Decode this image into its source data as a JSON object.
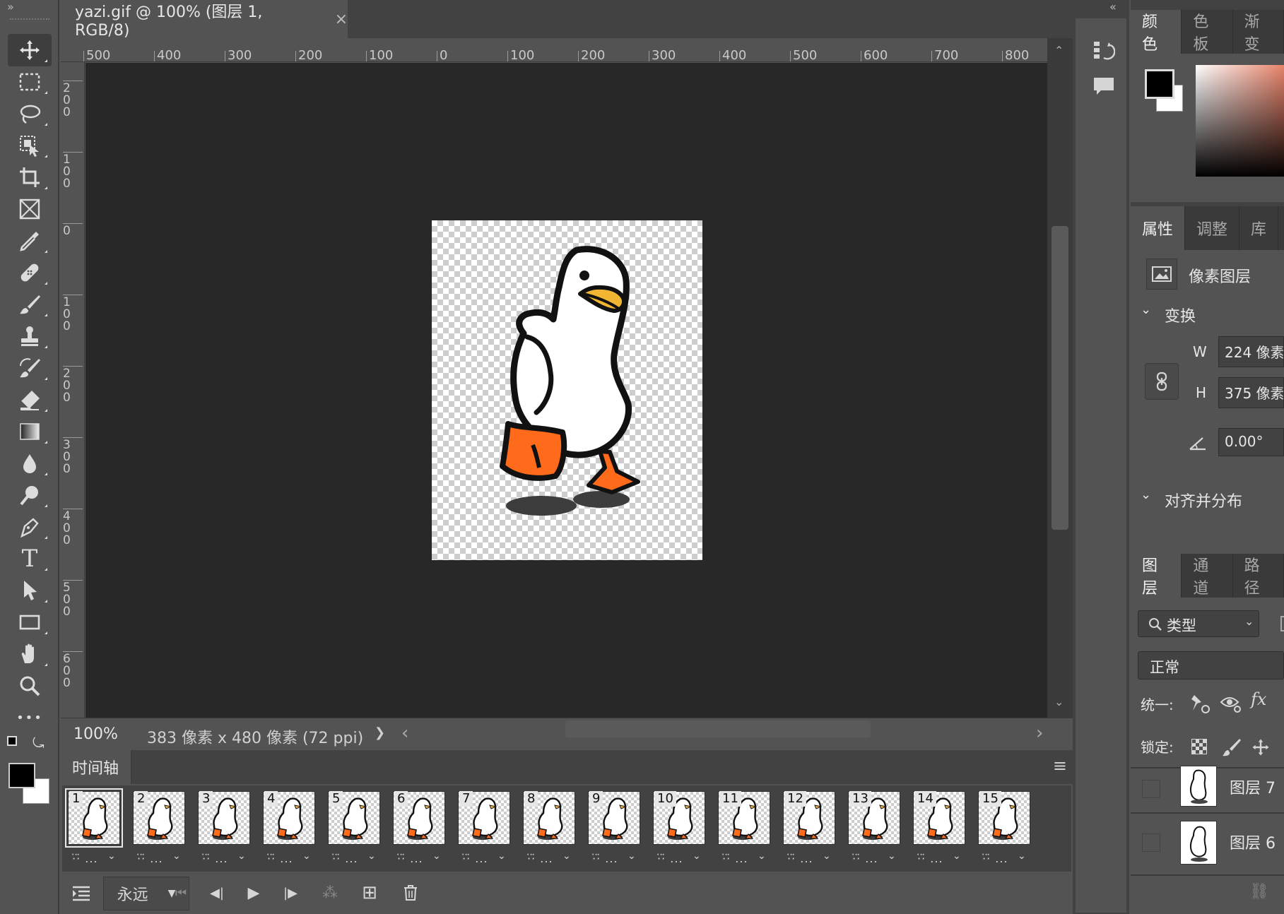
{
  "document": {
    "tab_title": "yazi.gif @ 100% (图层 1, RGB/8)",
    "close_glyph": "×"
  },
  "toolbar": {
    "collapse_glyph": "»",
    "tools": [
      "move-tool",
      "marquee-tool",
      "lasso-tool",
      "object-select-tool",
      "crop-tool",
      "frame-tool",
      "eyedropper-tool",
      "healing-brush-tool",
      "brush-tool",
      "clone-stamp-tool",
      "history-brush-tool",
      "eraser-tool",
      "gradient-tool",
      "blur-tool",
      "dodge-tool",
      "pen-tool",
      "type-tool",
      "path-select-tool",
      "rectangle-tool",
      "hand-tool",
      "zoom-tool",
      "more-tools"
    ],
    "type_glyph": "T",
    "more_glyph": "•••"
  },
  "ruler": {
    "horizontal": [
      "500",
      "400",
      "300",
      "200",
      "100",
      "0",
      "100",
      "200",
      "300",
      "400",
      "500",
      "600",
      "700",
      "800"
    ],
    "vertical": [
      [
        "2",
        "0",
        "0"
      ],
      [
        "1",
        "0",
        "0"
      ],
      [
        "0"
      ],
      [
        "1",
        "0",
        "0"
      ],
      [
        "2",
        "0",
        "0"
      ],
      [
        "3",
        "0",
        "0"
      ],
      [
        "4",
        "0",
        "0"
      ],
      [
        "5",
        "0",
        "0"
      ],
      [
        "6",
        "0",
        "0"
      ]
    ]
  },
  "status": {
    "zoom": "100%",
    "doc_info": "383 像素 x 480 像素 (72 ppi)",
    "more_arrow": "❯",
    "scroll_left": "‹",
    "scroll_right": "›"
  },
  "timeline": {
    "tab_label": "时间轴",
    "menu_glyph": "≡",
    "frames": [
      "1",
      "2",
      "3",
      "4",
      "5",
      "6",
      "7",
      "8",
      "9",
      "10",
      "11",
      "12",
      "13",
      "14",
      "15"
    ],
    "frame_delay": "·̇·̈ ...",
    "frame_dropdown": "⌄",
    "loop_option": "永远",
    "dropdown_arrow": "▼",
    "first_glyph": "⏮",
    "prev_glyph": "◀|",
    "play_glyph": "▶",
    "next_glyph": "|▶",
    "tween_glyph": "⁂",
    "new_frame_glyph": "⊞",
    "delete_glyph": "🗑"
  },
  "iconstrip": {
    "collapse_glyph": "«"
  },
  "color_panel": {
    "tabs": [
      "颜色",
      "色板",
      "渐变"
    ],
    "foreground": "#000000",
    "background": "#ffffff"
  },
  "properties_panel": {
    "tabs": [
      "属性",
      "调整",
      "库"
    ],
    "layer_type": "像素图层",
    "transform_label": "变换",
    "w_label": "W",
    "w_value": "224 像素",
    "h_label": "H",
    "h_value": "375 像素",
    "angle_value": "0.00°",
    "align_label": "对齐并分布",
    "chevron": "⌄"
  },
  "layers_panel": {
    "tabs": [
      "图层",
      "通道",
      "路径"
    ],
    "filter_label": "类型",
    "blend_mode": "正常",
    "unify_label": "统一:",
    "lock_label": "锁定:",
    "fx_glyph": "fx",
    "layers": [
      "图层 7",
      "图层 6"
    ],
    "link_glyph": "⛓"
  },
  "colors": {
    "ui_bg": "#535353",
    "canvas_bg": "#282828",
    "duck_orange": "#ff6b1a",
    "duck_beak": "#f2b632"
  }
}
